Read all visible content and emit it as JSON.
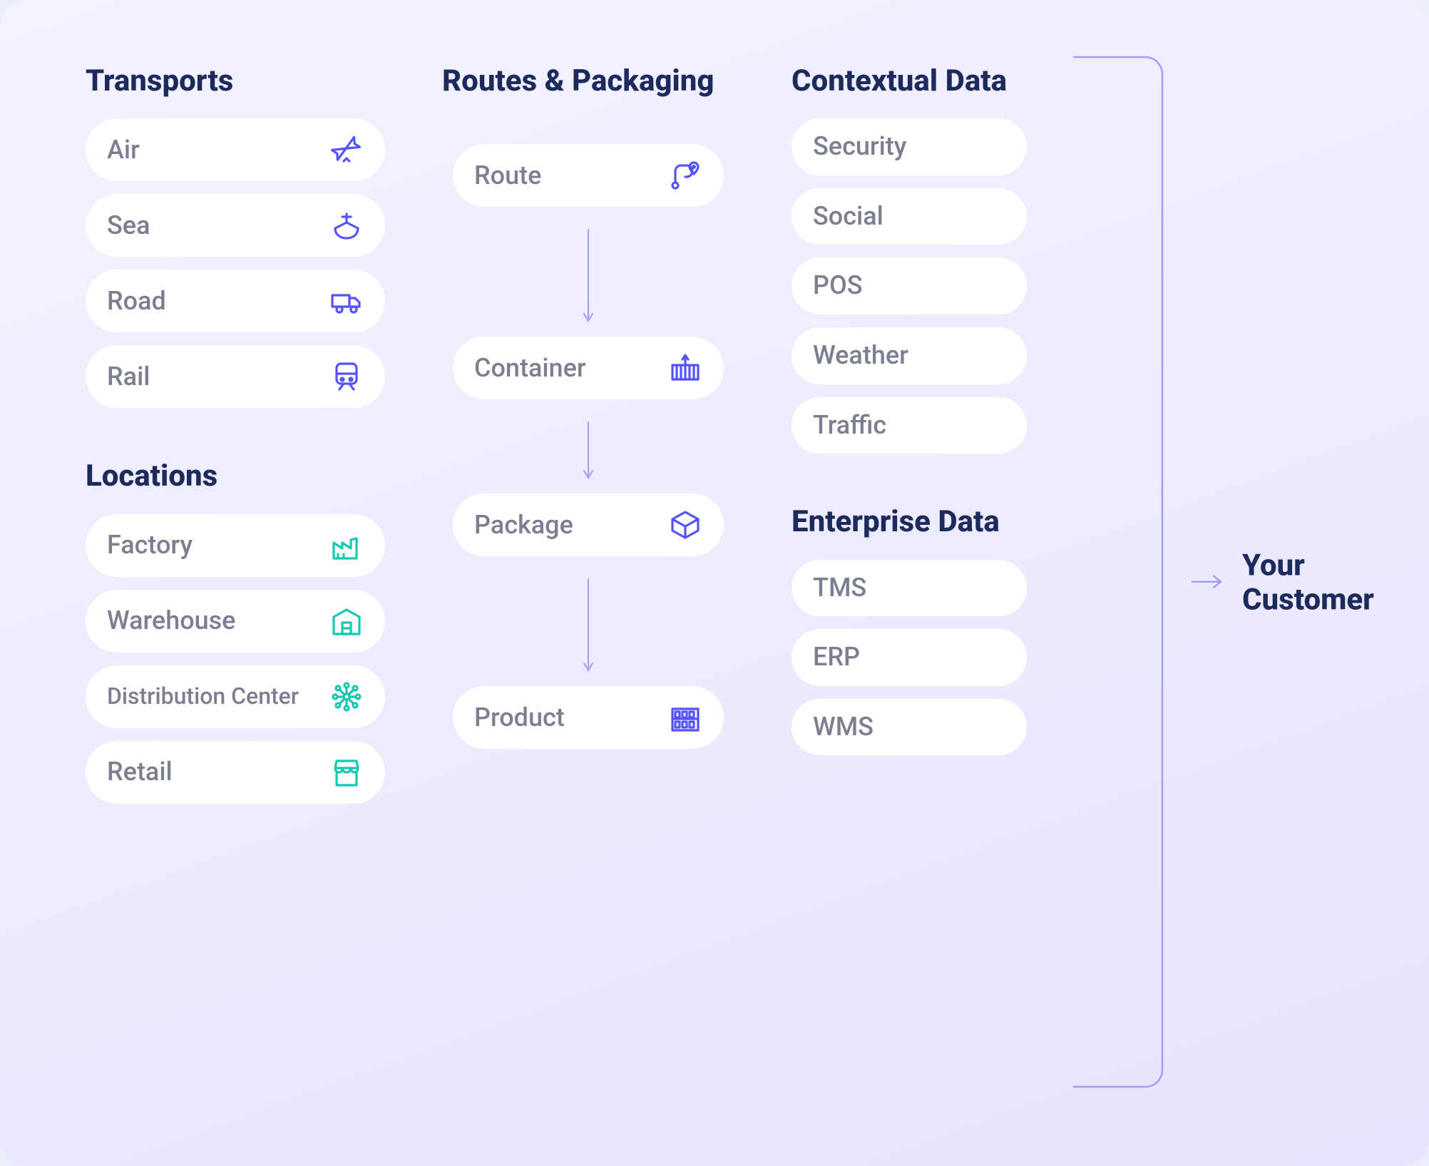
{
  "transports": {
    "title": "Transports",
    "items": [
      {
        "label": "Air",
        "icon": "airplane-icon"
      },
      {
        "label": "Sea",
        "icon": "ship-icon"
      },
      {
        "label": "Road",
        "icon": "truck-icon"
      },
      {
        "label": "Rail",
        "icon": "train-icon"
      }
    ]
  },
  "locations": {
    "title": "Locations",
    "items": [
      {
        "label": "Factory",
        "icon": "factory-icon"
      },
      {
        "label": "Warehouse",
        "icon": "warehouse-icon"
      },
      {
        "label": "Distribution Center",
        "icon": "network-icon"
      },
      {
        "label": "Retail",
        "icon": "storefront-icon"
      }
    ]
  },
  "routes_packaging": {
    "title": "Routes & Packaging",
    "items": [
      {
        "label": "Route",
        "icon": "route-icon"
      },
      {
        "label": "Container",
        "icon": "container-icon"
      },
      {
        "label": "Package",
        "icon": "package-icon"
      },
      {
        "label": "Product",
        "icon": "shelf-icon"
      }
    ]
  },
  "contextual_data": {
    "title": "Contextual Data",
    "items": [
      {
        "label": "Security"
      },
      {
        "label": "Social"
      },
      {
        "label": "POS"
      },
      {
        "label": "Weather"
      },
      {
        "label": "Traffic"
      }
    ]
  },
  "enterprise_data": {
    "title": "Enterprise Data",
    "items": [
      {
        "label": "TMS"
      },
      {
        "label": "ERP"
      },
      {
        "label": "WMS"
      }
    ]
  },
  "customer": {
    "label": "Your Customer"
  }
}
